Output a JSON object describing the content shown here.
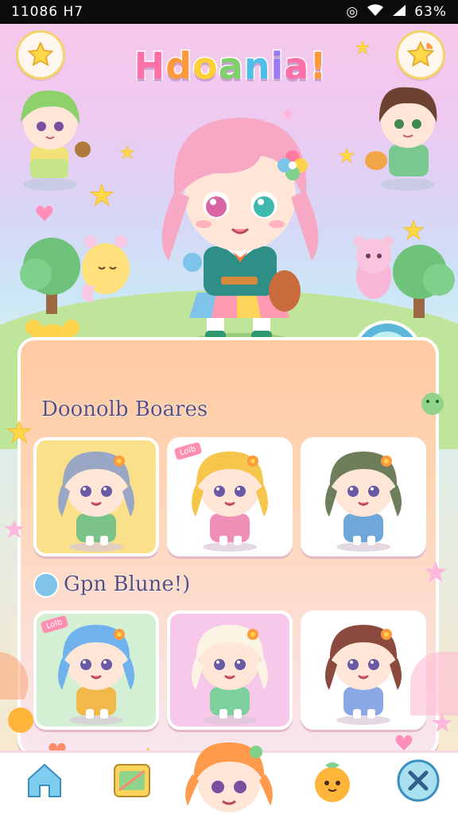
{
  "status_bar": {
    "time": "11086 H7",
    "battery": "63%"
  },
  "header": {
    "title_letters": [
      "H",
      "d",
      "o",
      "a",
      "n",
      "i",
      "a",
      "!"
    ],
    "left_button_icon": "star-icon",
    "right_button_icon": "star-badge-icon"
  },
  "featured_character": {
    "name": "featured-pink-hair-girl"
  },
  "heart_button": {
    "icon": "heart-icon"
  },
  "sections": [
    {
      "title": "Doonolb Boares",
      "cards": [
        {
          "hair": "#9aa7c4",
          "shirt": "#7cc38a",
          "bg": "#fbe08a",
          "tag": ""
        },
        {
          "hair": "#f5c64b",
          "shirt": "#f08fb6",
          "bg": "#ffffff",
          "tag": "Lolb"
        },
        {
          "hair": "#6e7d5a",
          "shirt": "#6fa8d8",
          "bg": "#ffffff",
          "tag": ""
        }
      ]
    },
    {
      "title": "Gpn Blune!)",
      "cards": [
        {
          "hair": "#6fb2ee",
          "shirt": "#f1b84a",
          "bg": "#d4f0d4",
          "tag": "Lolb"
        },
        {
          "hair": "#fbf4e4",
          "shirt": "#7dcf9c",
          "bg": "#f8c8ea",
          "tag": ""
        },
        {
          "hair": "#8a4a3e",
          "shirt": "#8aa8e6",
          "bg": "#ffffff",
          "tag": ""
        }
      ]
    }
  ],
  "bottom_nav": {
    "items": [
      {
        "icon": "home-icon"
      },
      {
        "icon": "card-album-icon"
      },
      {
        "icon": "character-icon"
      },
      {
        "icon": "pet-icon"
      },
      {
        "icon": "close-icon"
      }
    ]
  },
  "colors": {
    "accent_pink": "#ff6fa8",
    "star_yellow": "#ffd84a",
    "panel_peach": "#ffc9a2"
  }
}
